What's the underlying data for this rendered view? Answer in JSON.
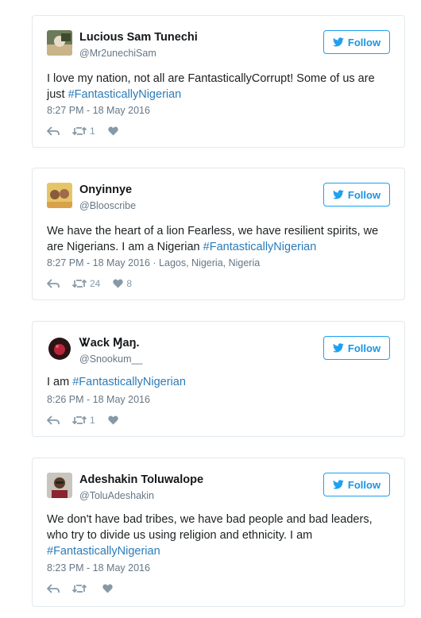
{
  "colors": {
    "accent": "#1da1f2",
    "link": "#2b7bb9",
    "muted": "#657786",
    "icon": "#8899a6"
  },
  "tweets": [
    {
      "name": "Lucious Sam Tunechi",
      "handle": "@Mr2unechiSam",
      "follow_label": "Follow",
      "text": "I love my nation, not all are FantasticallyCorrupt! Some of us are just ",
      "hashtag": "#FantasticallyNigerian",
      "meta": "8:27 PM - 18 May 2016",
      "retweets": "1",
      "likes": ""
    },
    {
      "name": "Onyinnye",
      "handle": "@Blooscribe",
      "follow_label": "Follow",
      "text": "We have the heart of a lion Fearless, we have resilient spirits, we are Nigerians. I am a Nigerian ",
      "hashtag": "#FantasticallyNigerian",
      "meta": "8:27 PM - 18 May 2016 · Lagos, Nigeria, Nigeria",
      "retweets": "24",
      "likes": "8"
    },
    {
      "name": "Ꮤack Ɱaŋ.",
      "handle": "@Snookum__",
      "follow_label": "Follow",
      "text": "I am ",
      "hashtag": "#FantasticallyNigerian",
      "meta": "8:26 PM - 18 May 2016",
      "retweets": "1",
      "likes": ""
    },
    {
      "name": "Adeshakin Toluwalope",
      "handle": "@ToluAdeshakin",
      "follow_label": "Follow",
      "text": "We don't have bad tribes, we have bad people and bad leaders, who try to divide us using religion and ethnicity. I am ",
      "hashtag": "#FantasticallyNigerian",
      "meta": "8:23 PM - 18 May 2016",
      "retweets": "",
      "likes": ""
    }
  ]
}
